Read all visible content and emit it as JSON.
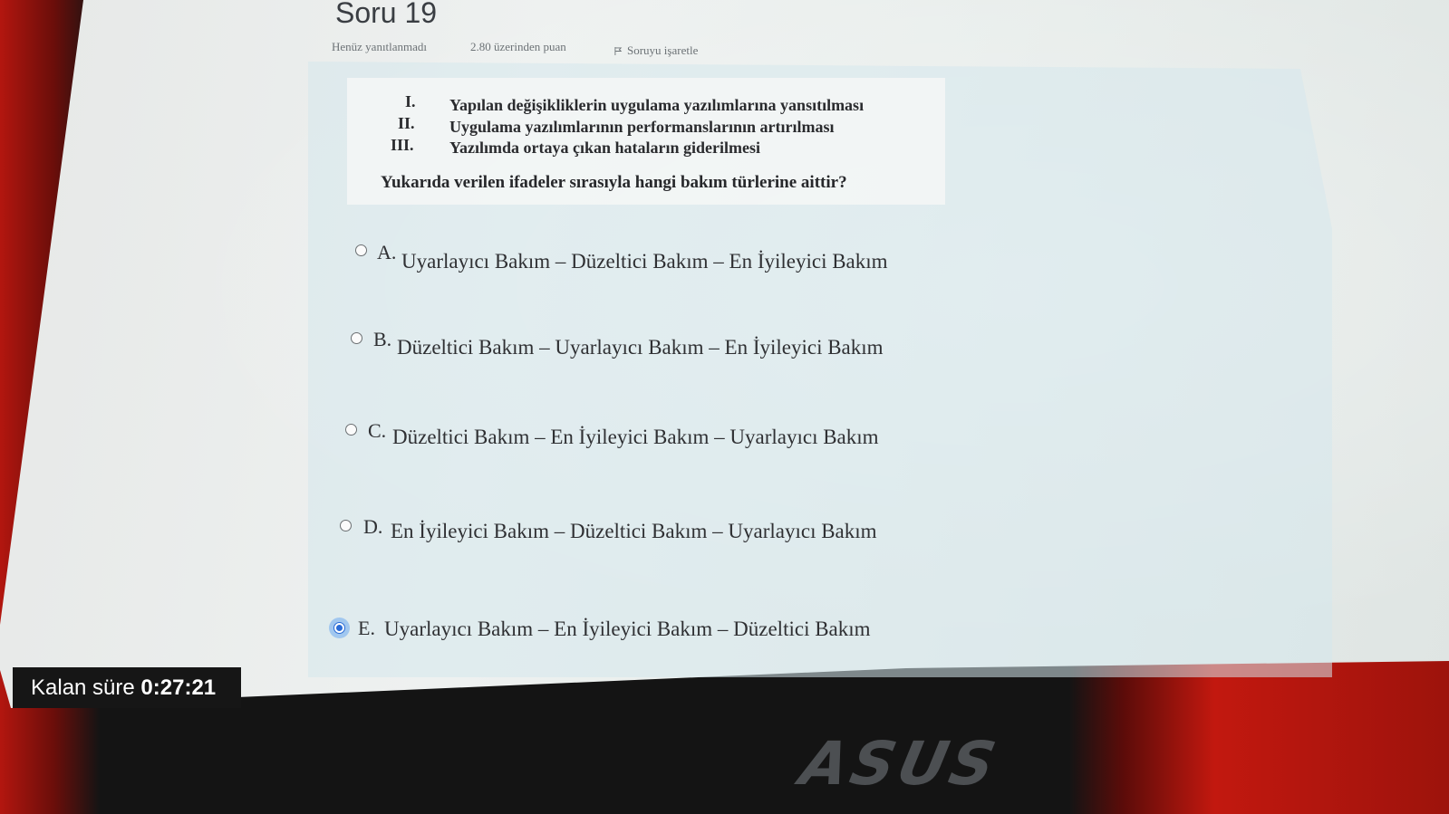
{
  "question": {
    "title": "Soru 19",
    "status": "Henüz yanıtlanmadı",
    "points": "2.80 üzerinden puan",
    "flag_label": "Soruyu işaretle",
    "items": [
      {
        "num": "I.",
        "text": "Yapılan değişikliklerin uygulama yazılımlarına yansıtılması"
      },
      {
        "num": "II.",
        "text": "Uygulama yazılımlarının performanslarının artırılması"
      },
      {
        "num": "III.",
        "text": "Yazılımda ortaya çıkan hataların giderilmesi"
      }
    ],
    "prompt": "Yukarıda verilen ifadeler sırasıyla hangi bakım türlerine aittir?"
  },
  "options": [
    {
      "letter": "A.",
      "text": "Uyarlayıcı Bakım – Düzeltici Bakım – En İyileyici Bakım",
      "selected": false
    },
    {
      "letter": "B.",
      "text": "Düzeltici Bakım – Uyarlayıcı Bakım – En İyileyici Bakım",
      "selected": false
    },
    {
      "letter": "C.",
      "text": "Düzeltici Bakım – En İyileyici Bakım – Uyarlayıcı Bakım",
      "selected": false
    },
    {
      "letter": "D.",
      "text": "En İyileyici Bakım – Düzeltici Bakım – Uyarlayıcı Bakım",
      "selected": false
    },
    {
      "letter": "E.",
      "text": "Uyarlayıcı Bakım – En İyileyici Bakım – Düzeltici Bakım",
      "selected": true
    }
  ],
  "timer": {
    "label": "Kalan süre",
    "time": "0:27:21"
  },
  "device": {
    "brand": "ASUS"
  },
  "colors": {
    "selected_radio": "#2b6cd6",
    "screen_bg": "#e9eeec",
    "bezel_red": "#b3160f"
  }
}
